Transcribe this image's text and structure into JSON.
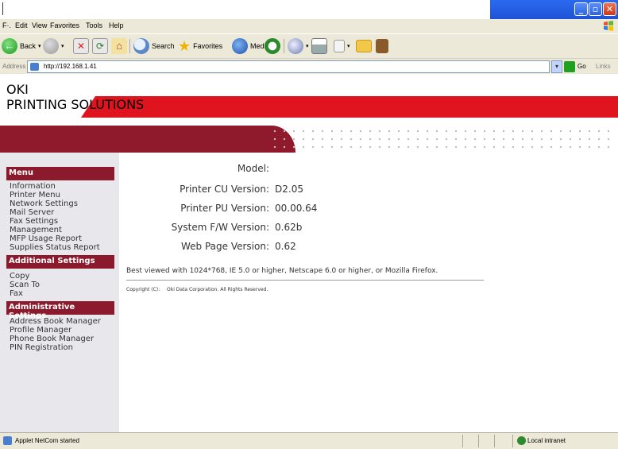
{
  "menubar": {
    "items": [
      "Edit",
      "View",
      "Favorites",
      "Tools",
      "Help"
    ]
  },
  "toolbar": {
    "back_label": "Back",
    "search_label": "Search",
    "favorites_label": "Favorites",
    "media_label": "Media"
  },
  "address": {
    "label": "Address",
    "url": "http://192.168.1.41",
    "go_label": "Go",
    "links_label": "Links"
  },
  "logo": {
    "brand": "OKI",
    "tagline": "PRINTING SOLUTIONS"
  },
  "sidebar": {
    "menu_header": "Menu",
    "menu_items": [
      "Information",
      "Printer Menu",
      "Network Settings",
      "Mail Server",
      "Fax Settings",
      "Management",
      "MFP Usage Report",
      "Supplies Status Report"
    ],
    "additional_header": "Additional Settings",
    "additional_items": [
      "Copy",
      "Scan To",
      "Fax"
    ],
    "admin_header": "Administrative Settings",
    "admin_items": [
      "Address Book Manager",
      "Profile Manager",
      "Phone Book Manager",
      "PIN Registration"
    ]
  },
  "info": {
    "model_label": "Model:",
    "model_value": "",
    "cu_label": "Printer CU Version:",
    "cu_value": "D2.05",
    "pu_label": "Printer PU Version:",
    "pu_value": "00.00.64",
    "fw_label": "System F/W Version:",
    "fw_value": "0.62b",
    "web_label": "Web Page Version:",
    "web_value": "0.62"
  },
  "footer": {
    "best_viewed": "Best viewed with 1024*768, IE 5.0 or higher, Netscape 6.0 or higher, or Mozilla Firefox.",
    "copyright_label": "Copyright (C):",
    "copyright_text": "Oki Data Corporation. All Rights Reserved."
  },
  "status": {
    "message": "Applet NetCom started",
    "zone": "Local intranet"
  },
  "colors": {
    "brand_red": "#e0141e",
    "maroon": "#8a1a2c",
    "xp_blue": "#2a6af0"
  }
}
